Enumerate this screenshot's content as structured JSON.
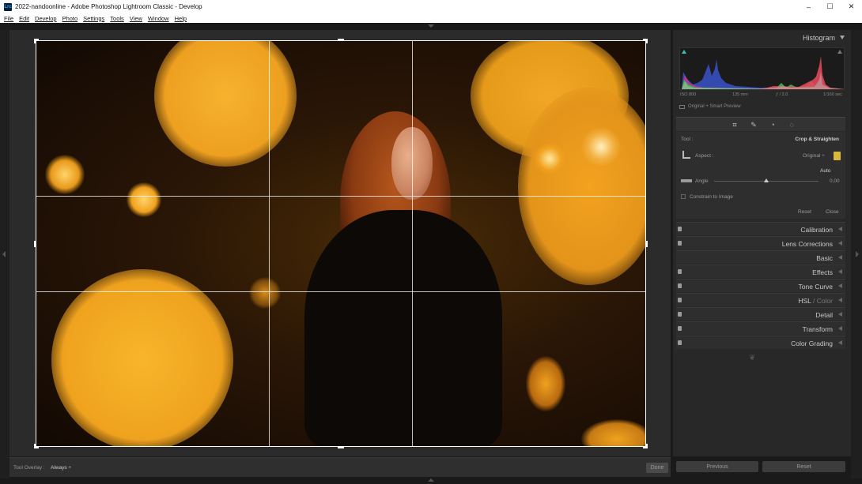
{
  "window": {
    "icon_text": "Lrc",
    "title": "2022-nandoonline - Adobe Photoshop Lightroom Classic - Develop",
    "minimize": "–",
    "maximize": "☐",
    "close": "✕"
  },
  "menu": [
    "File",
    "Edit",
    "Develop",
    "Photo",
    "Settings",
    "Tools",
    "View",
    "Window",
    "Help"
  ],
  "toolbar": {
    "overlay_label": "Tool Overlay :",
    "overlay_value": "Always ÷",
    "done_label": "Done"
  },
  "histogram": {
    "title": "Histogram",
    "iso": "ISO 800",
    "focal": "135 mm",
    "aperture": "ƒ / 2.0",
    "shutter": "1/160 sec",
    "preview": "Original + Smart Preview"
  },
  "crop_tool": {
    "tool_label": "Tool :",
    "tool_name": "Crop & Straighten",
    "aspect_label": "Aspect :",
    "aspect_value": "Original ÷",
    "auto_label": "Auto",
    "angle_label": "Angle",
    "angle_value": "0,00",
    "angle_fraction": 0.5,
    "constrain_label": "Constrain to Image",
    "reset_label": "Reset",
    "close_label": "Close"
  },
  "panels": [
    {
      "label": "Calibration"
    },
    {
      "label": "Lens Corrections"
    },
    {
      "label": "Basic"
    },
    {
      "label": "Effects"
    },
    {
      "label": "Tone Curve"
    },
    {
      "label": "HSL",
      "sep": " / ",
      "label2": "Color"
    },
    {
      "label": "Detail"
    },
    {
      "label": "Transform"
    },
    {
      "label": "Color Grading"
    }
  ],
  "bottom": {
    "previous_label": "Previous",
    "reset_label": "Reset"
  },
  "colors": {
    "bokeh": "#f0a21e",
    "accent_lock": "#d8b73d"
  }
}
